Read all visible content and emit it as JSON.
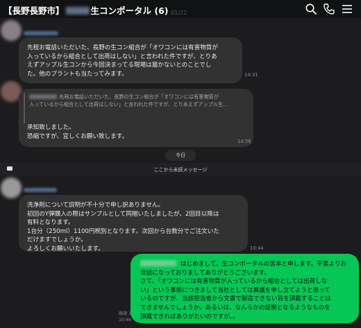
{
  "header": {
    "title_prefix": "【長野長野市】",
    "title_suffix": "生コンポータル (6)"
  },
  "ghost": {
    "date": "01/22"
  },
  "messages": [
    {
      "text": "先程お電話いただいた、長野の生コン組合が「オワコンには有害物質が\n入っているから組合として出荷はしない」と言われた件ですが、とりあ\nえずアップル生コンから今回決まってる現場は届かないとのことでし\nた。他のプラントも当たってみます。",
      "time": "14:31"
    },
    {
      "quote": "先程お電話いただいた、長野の生コン組合が「オワコンには有害物質が\n入っているから組合として出荷はしない」と言われた件ですが、とりあえずアップル生…",
      "text": "承知致しました。\n恐縮ですが、宜しくお願い致します。",
      "time": "14:56"
    },
    {
      "text": "洗浄剤について説明が不十分で申し訳ありません。\n初回のY弾購入の際はサンプルとして同梱いたしましたが、2回目以降は\n有料となります。\n1台分（250ml）1100円税別となります。次回から台数分でご注文いた\nだけますでしょうか。\nよろしくお願いいたします。",
      "time": "10:44"
    },
    {
      "text": "はじめまして。生コンポータルの宮本と申します。平素よりお\n世話になっておりましてありがとうございます。\nさて、「オワコンには有害物質が入っているから組合としては出荷しな\nい」という事態につきまして当社としては異議を申し立てようと思って\nいるのですが、当該担当者から文書で製造できない旨を頂戴することは\nできませんでしょうか。あるいは、なんらかの証拠となるようなものを\n頂戴できればありがたいのですが。。",
      "read_label": "既読 1",
      "time": "10:46"
    }
  ],
  "day_separator": "今日",
  "unread_separator": "ここから未読メッセージ"
}
